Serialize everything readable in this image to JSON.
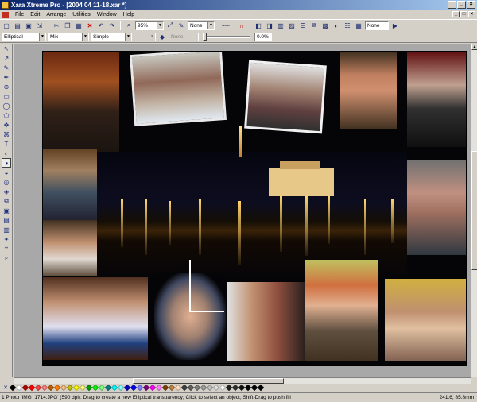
{
  "window": {
    "title": "Xara Xtreme Pro - [2004 04 11-18.xar *]",
    "min": "_",
    "max": "□",
    "close": "×"
  },
  "menu": [
    {
      "label": "File"
    },
    {
      "label": "Edit"
    },
    {
      "label": "Arrange"
    },
    {
      "label": "Utilities"
    },
    {
      "label": "Window"
    },
    {
      "label": "Help"
    }
  ],
  "toolbar1": {
    "zoom": "95%",
    "line_width": "None",
    "fill_style": "None"
  },
  "toolbar2": {
    "shape": "Elliptical",
    "type": "Mix",
    "mode": "Simple",
    "blank": "",
    "percent_label": "None",
    "percent": "0.0%"
  },
  "palette": {
    "colors": [
      "#000000",
      "#ffffff",
      "#c00000",
      "#ff0000",
      "#ff4040",
      "#ff8080",
      "#c06000",
      "#ff8000",
      "#ffc080",
      "#c0c000",
      "#ffff00",
      "#ffff80",
      "#00a000",
      "#00ff00",
      "#80ff80",
      "#008080",
      "#00ffff",
      "#80ffff",
      "#0000c0",
      "#0000ff",
      "#8080ff",
      "#800080",
      "#ff00ff",
      "#ff80ff",
      "#804000",
      "#c08040",
      "#ffe0c0",
      "#404040",
      "#606060",
      "#808080",
      "#a0a0a0",
      "#c0c0c0",
      "#e0e0e0",
      "#ffffff",
      "#202020",
      "#303030",
      "#101010",
      "#000000",
      "#000000",
      "#000000"
    ]
  },
  "status": {
    "message": "1 Photo 'IMG_1714.JPG' (590 dpi): Drag to create a new Elliptical transparency; Click to select an object; Shift-Drag to push fill",
    "coords": "241.6, 85.8mm"
  }
}
